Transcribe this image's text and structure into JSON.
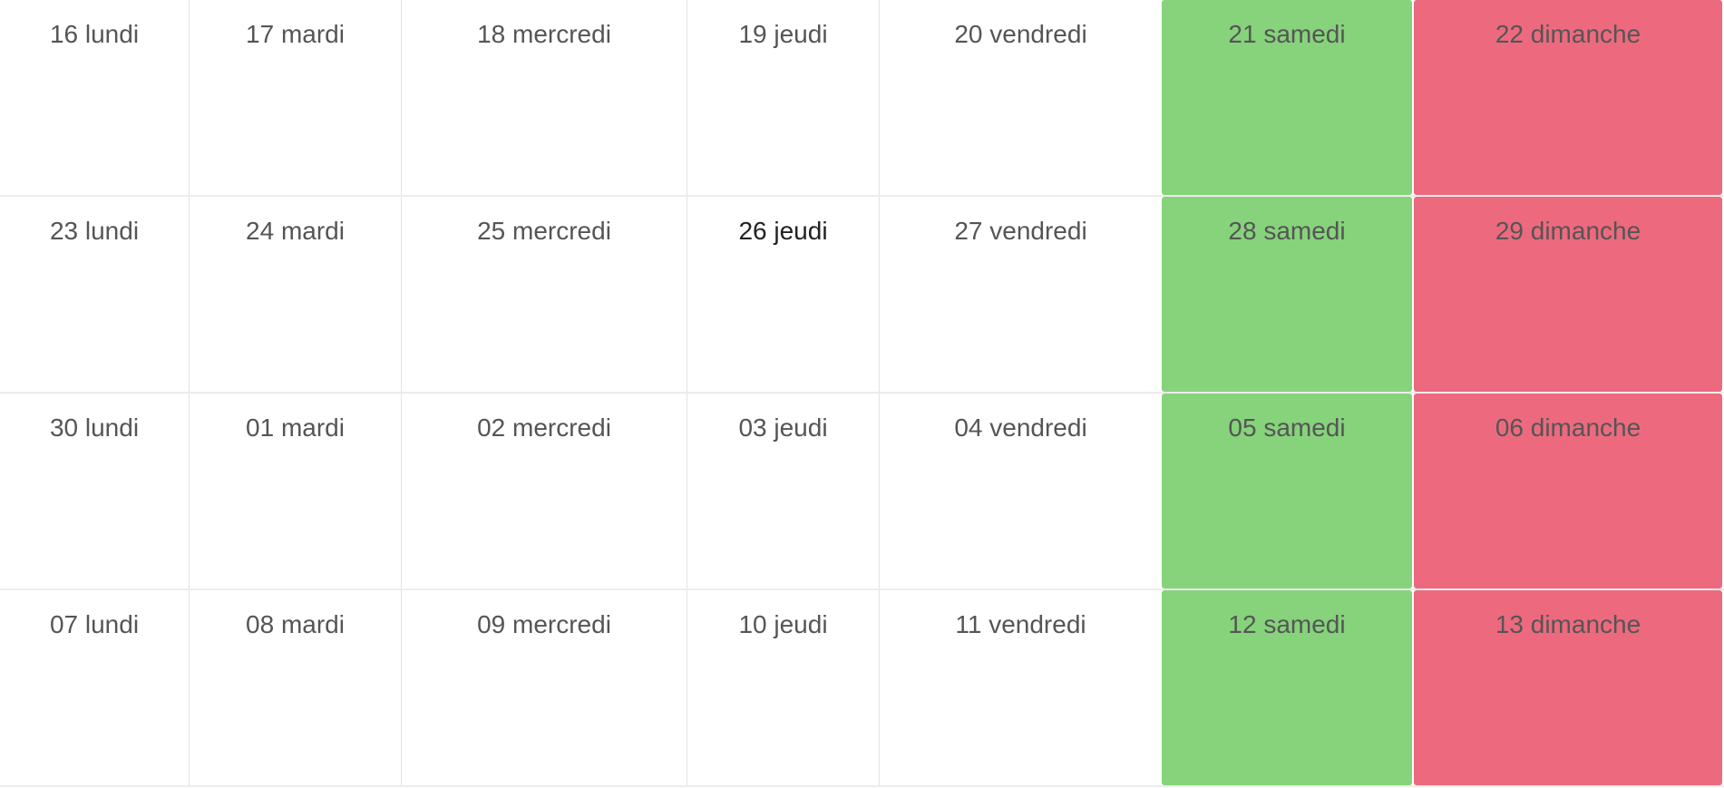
{
  "colors": {
    "saturday_bg": "#86d37b",
    "sunday_bg": "#ed6a7e",
    "weekday_text": "#555555",
    "today_text": "#222222"
  },
  "weeks": [
    {
      "days": [
        "16 lundi",
        "17 mardi",
        "18 mercredi",
        "19 jeudi",
        "20 vendredi",
        "21 samedi",
        "22 dimanche"
      ]
    },
    {
      "days": [
        "23 lundi",
        "24 mardi",
        "25 mercredi",
        "26 jeudi",
        "27 vendredi",
        "28 samedi",
        "29 dimanche"
      ]
    },
    {
      "days": [
        "30 lundi",
        "01 mardi",
        "02 mercredi",
        "03 jeudi",
        "04 vendredi",
        "05 samedi",
        "06 dimanche"
      ]
    },
    {
      "days": [
        "07 lundi",
        "08 mardi",
        "09 mercredi",
        "10 jeudi",
        "11 vendredi",
        "12 samedi",
        "13 dimanche"
      ]
    }
  ]
}
